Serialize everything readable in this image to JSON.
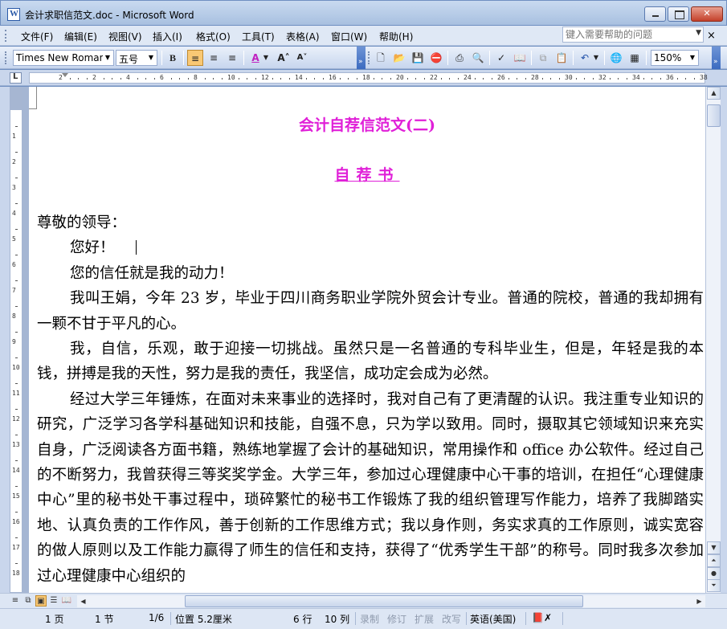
{
  "window": {
    "title": "会计求职信范文.doc - Microsoft Word"
  },
  "menu": {
    "items": [
      "文件(F)",
      "编辑(E)",
      "视图(V)",
      "插入(I)",
      "格式(O)",
      "工具(T)",
      "表格(A)",
      "窗口(W)",
      "帮助(H)"
    ],
    "help_placeholder": "键入需要帮助的问题"
  },
  "toolbar": {
    "font_name": "Times New Roman",
    "font_size": "五号",
    "bold_label": "B",
    "zoom": "150%"
  },
  "ruler": {
    "h_ticks": [
      "2",
      "2",
      "4",
      "6",
      "8",
      "10",
      "12",
      "14",
      "16",
      "18",
      "20",
      "22",
      "24",
      "26",
      "28",
      "30",
      "32",
      "34",
      "36",
      "38"
    ],
    "v_ticks": [
      "1",
      "2",
      "3",
      "4",
      "5",
      "6",
      "7",
      "8",
      "9",
      "10",
      "11",
      "12",
      "13",
      "14",
      "15",
      "16",
      "17",
      "18",
      "19"
    ]
  },
  "document": {
    "title": "会计自荐信范文(二)",
    "subtitle": "自荐书",
    "salutation": "尊敬的领导：",
    "paragraphs": [
      "您好！",
      "您的信任就是我的动力！",
      "我叫王娟，今年 23 岁，毕业于四川商务职业学院外贸会计专业。普通的院校，普通的我却拥有一颗不甘于平凡的心。",
      "我，自信，乐观，敢于迎接一切挑战。虽然只是一名普通的专科毕业生，但是，年轻是我的本钱，拼搏是我的天性，努力是我的责任，我坚信，成功定会成为必然。",
      "经过大学三年锤炼，在面对未来事业的选择时，我对自己有了更清醒的认识。我注重专业知识的研究，广泛学习各学科基础知识和技能，自强不息，只为学以致用。同时，摄取其它领域知识来充实自身，广泛阅读各方面书籍，熟练地掌握了会计的基础知识，常用操作和 office 办公软件。经过自己的不断努力，我曾获得三等奖奖学金。大学三年，参加过心理健康中心干事的培训，在担任“心理健康中心”里的秘书处干事过程中，琐碎繁忙的秘书工作锻炼了我的组织管理写作能力，培养了我脚踏实地、认真负责的工作作风，善于创新的工作思维方式；我以身作则，务实求真的工作原则，诚实宽容的做人原则以及工作能力赢得了师生的信任和支持，获得了“优秀学生干部”的称号。同时我多次参加过心理健康中心组织的"
    ]
  },
  "status": {
    "page": "1 页",
    "section": "1 节",
    "page_of": "1/6",
    "position": "位置 5.2厘米",
    "line": "6 行",
    "column": "10 列",
    "rec": "录制",
    "trk": "修订",
    "ext": "扩展",
    "ovr": "改写",
    "language": "英语(美国)"
  }
}
